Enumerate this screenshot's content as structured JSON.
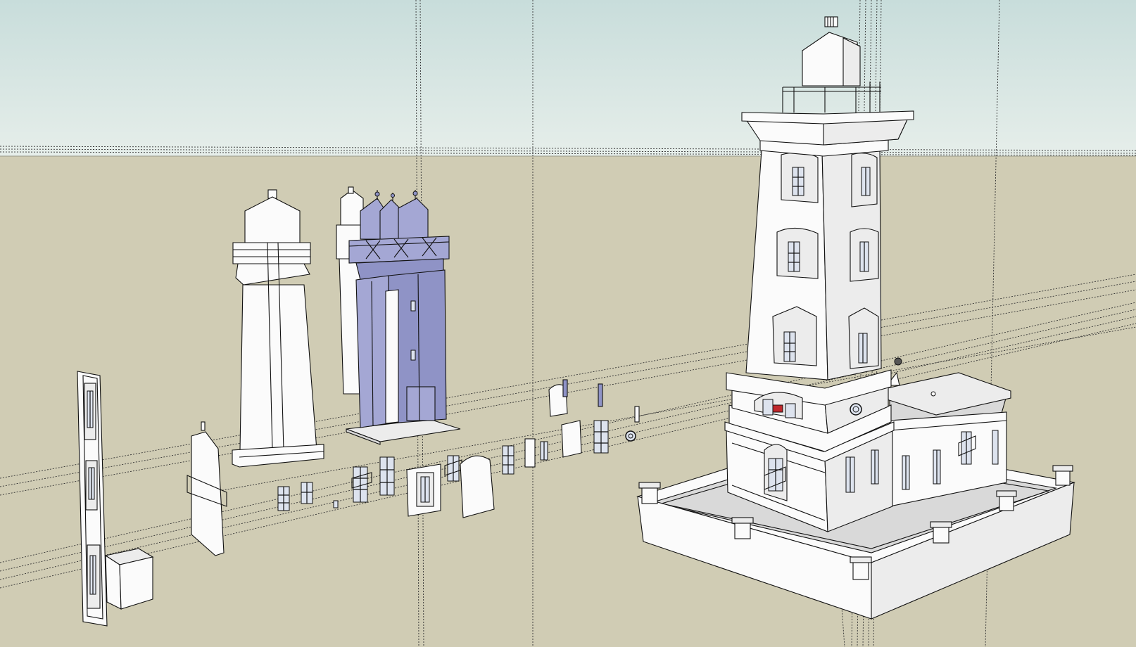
{
  "app": {
    "type": "3d-modeling-viewport"
  },
  "scene": {
    "sky_color": "#dbe7e3",
    "sky_top_color": "#c9dedc",
    "ground_color": "#d0ccb4",
    "selection_color": "#a4a7d4",
    "edge_color": "#111111",
    "objects": [
      {
        "name": "lighthouse-complete-model",
        "selected": false
      },
      {
        "name": "lighthouse-tower-profile",
        "selected": false
      },
      {
        "name": "lighthouse-tower-selected-group",
        "selected": true
      },
      {
        "name": "tower-wall-panel-with-windows",
        "selected": false
      },
      {
        "name": "window-components-row",
        "selected": false
      },
      {
        "name": "small-annex-block",
        "selected": false
      }
    ]
  }
}
